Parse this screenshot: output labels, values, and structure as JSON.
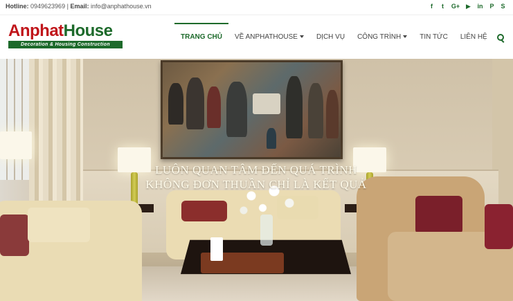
{
  "topbar": {
    "hotline_label": "Hotline:",
    "hotline_value": "0949623969",
    "separator": "|",
    "email_label": "Email:",
    "email_value": "info@anphathouse.vn",
    "social_icons": [
      "facebook-icon",
      "twitter-icon",
      "google-plus-icon",
      "youtube-icon",
      "linkedin-icon",
      "pinterest-icon",
      "skype-icon"
    ],
    "social_glyphs": [
      "f",
      "t",
      "G+",
      "▶",
      "in",
      "P",
      "S"
    ]
  },
  "logo": {
    "part1": "Anphat",
    "part2": "House",
    "tagline": "Decoration & Housing Construction"
  },
  "nav": {
    "items": [
      {
        "label": "TRANG CHỦ",
        "active": true,
        "dropdown": false
      },
      {
        "label": "VỀ ANPHATHOUSE",
        "active": false,
        "dropdown": true
      },
      {
        "label": "DỊCH VỤ",
        "active": false,
        "dropdown": false
      },
      {
        "label": "CÔNG TRÌNH",
        "active": false,
        "dropdown": true
      },
      {
        "label": "TIN TỨC",
        "active": false,
        "dropdown": false
      },
      {
        "label": "LIÊN HỆ",
        "active": false,
        "dropdown": false
      }
    ]
  },
  "hero": {
    "slogan_line1": "LUÔN QUAN TÂM ĐẾN QUÁ TRÌNH",
    "slogan_line2": "KHÔNG ĐƠN THUẦN CHỈ LÀ KẾT QUẢ"
  },
  "colors": {
    "brand_green": "#1d6a2b",
    "brand_red": "#c0151a"
  }
}
